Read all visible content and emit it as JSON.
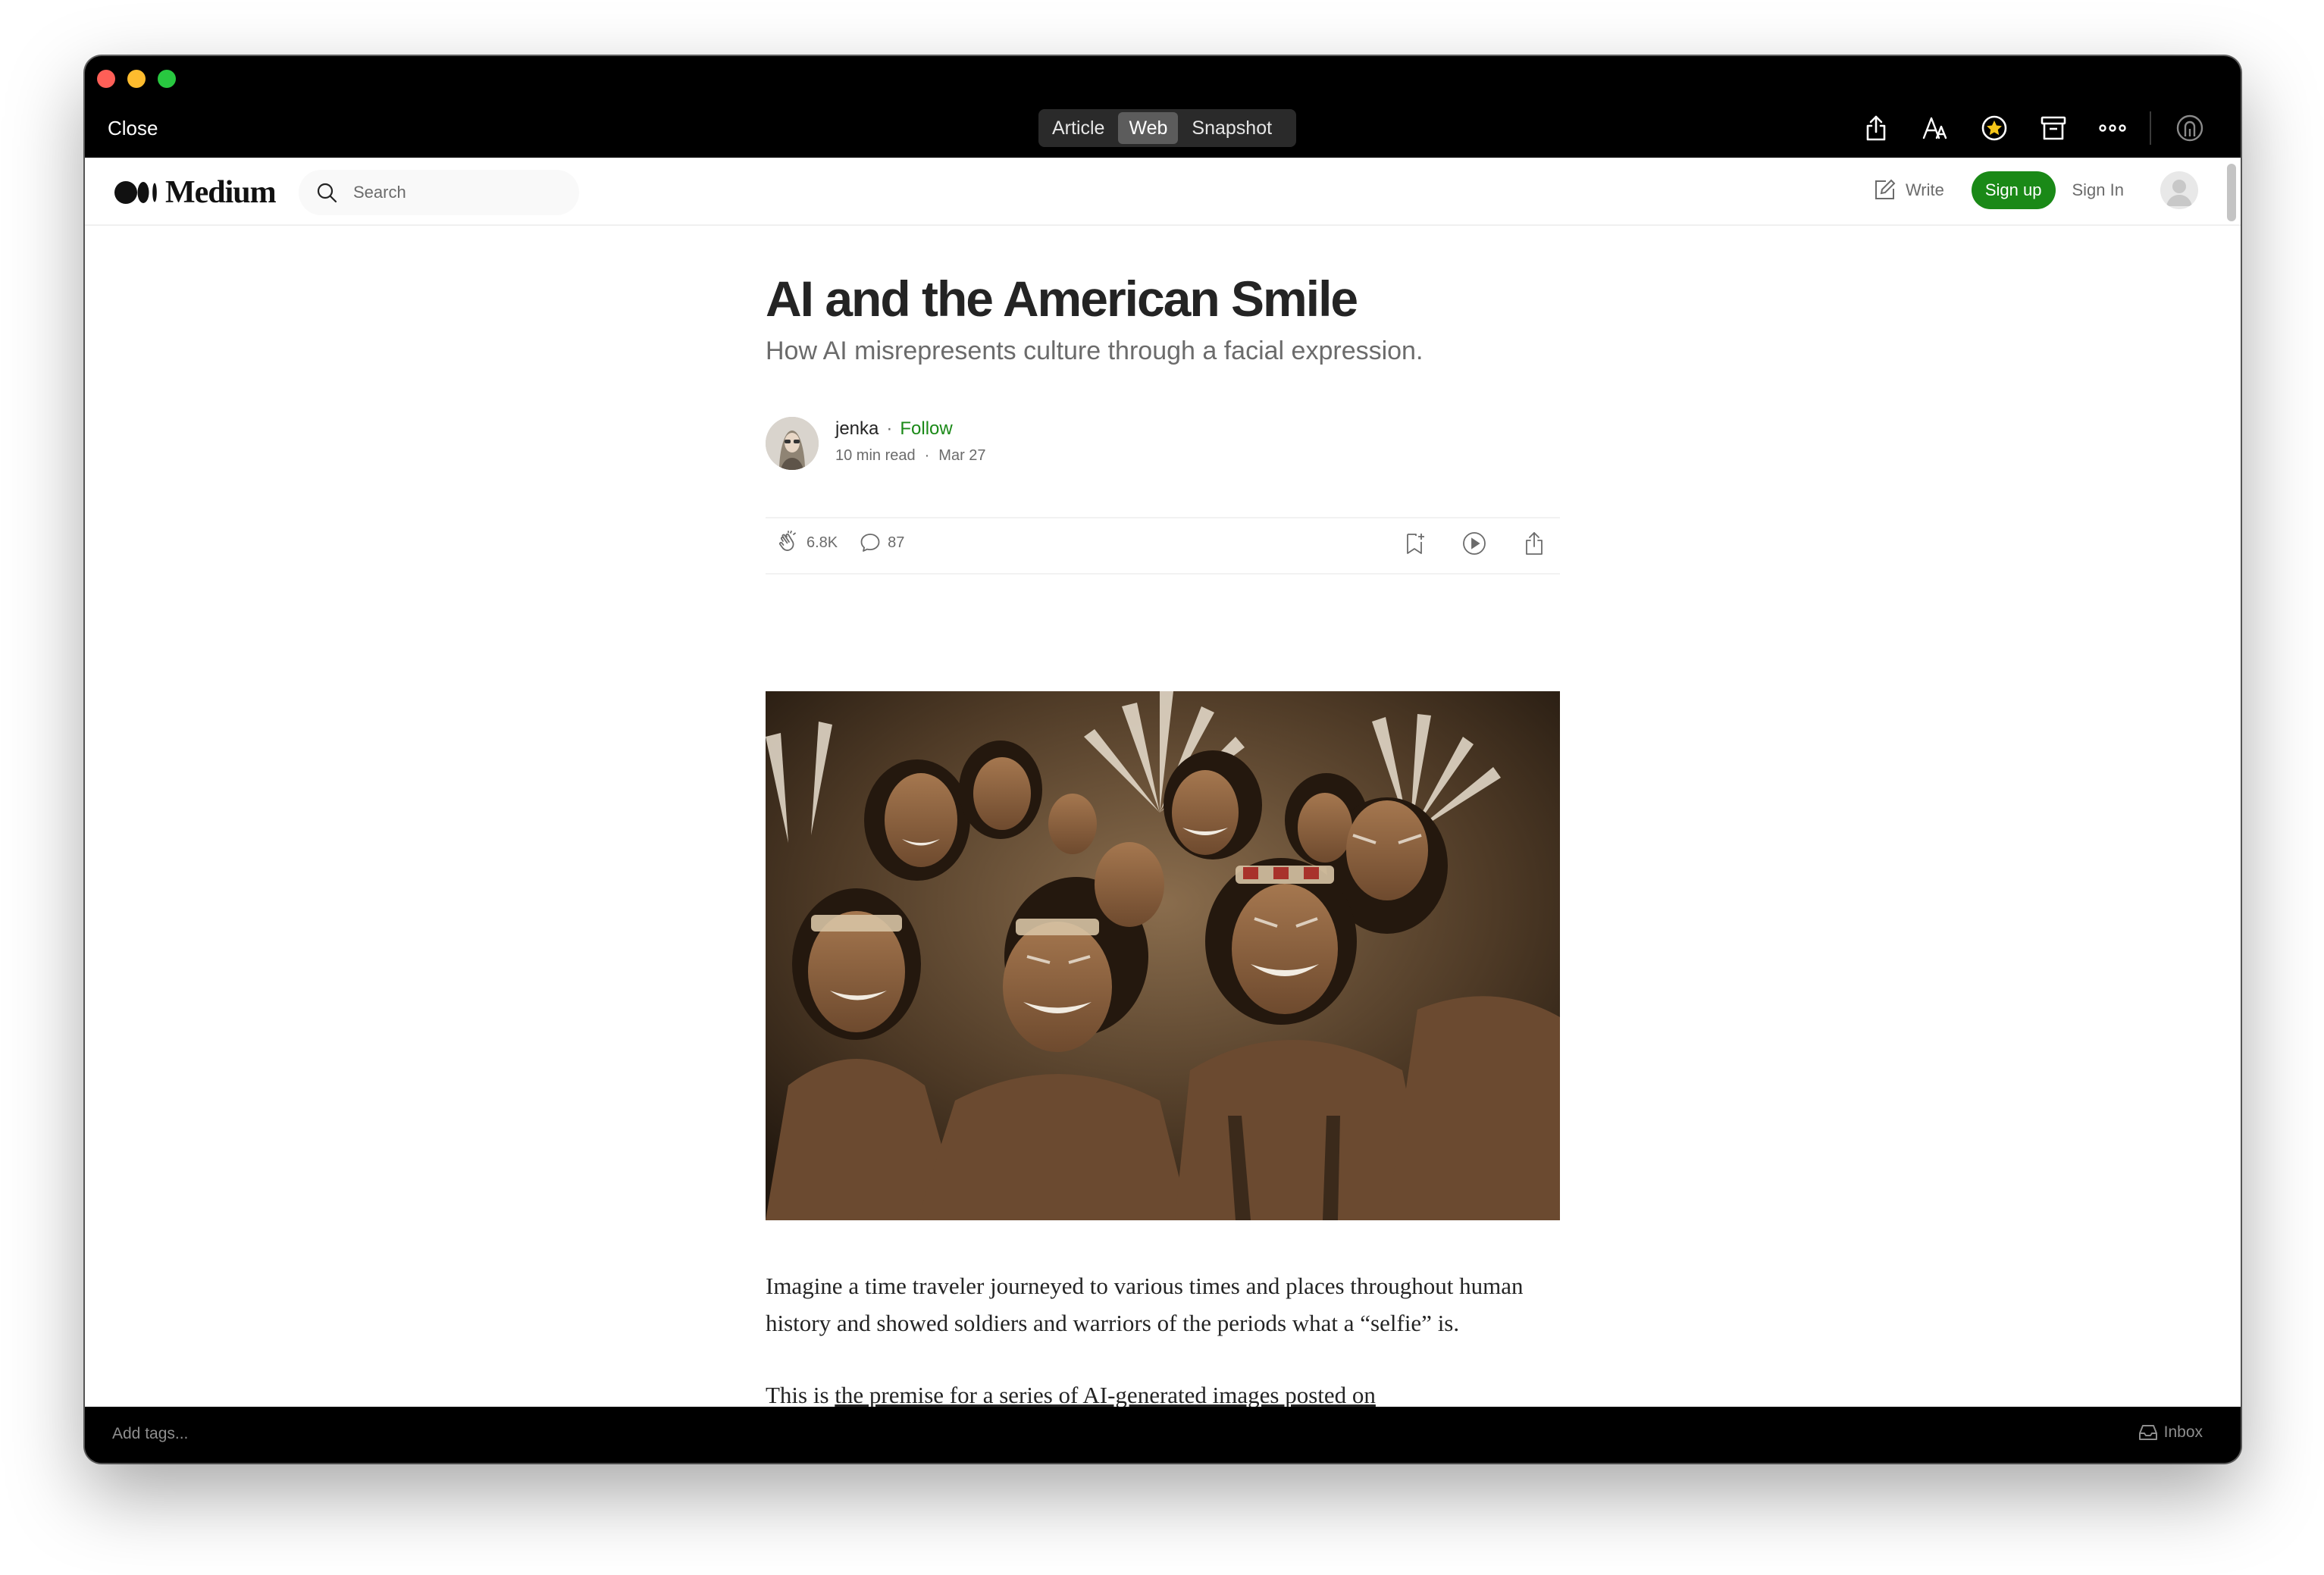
{
  "toolbar": {
    "close_label": "Close",
    "view_modes": [
      "Article",
      "Web",
      "Snapshot"
    ],
    "active_mode": "Web"
  },
  "site": {
    "logo_text": "Medium",
    "search_placeholder": "Search",
    "write_label": "Write",
    "signup_label": "Sign up",
    "signin_label": "Sign In"
  },
  "article": {
    "title": "AI and the American Smile",
    "subtitle": "How AI misrepresents culture through a facial expression.",
    "author": "jenka",
    "follow_label": "Follow",
    "read_time": "10 min read",
    "date": "Mar 27",
    "claps": "6.8K",
    "responses": "87",
    "paragraph1": "Imagine a time traveler journeyed to various times and places throughout human history and showed soldiers and warriors of the periods what a “selfie” is.",
    "paragraph2_prefix": "This is ",
    "paragraph2_link": "the premise for a series of AI-generated images posted on"
  },
  "footer": {
    "tags_placeholder": "Add tags...",
    "inbox_label": "Inbox"
  },
  "colors": {
    "accent_green": "#1a8917",
    "title_text": "#242424",
    "secondary_text": "#6b6b6b"
  },
  "icons": [
    "share-icon",
    "text-size-icon",
    "star-badge-icon",
    "archive-icon",
    "more-icon",
    "account-icon",
    "search-icon",
    "write-icon",
    "clap-icon",
    "comment-icon",
    "bookmark-icon",
    "play-icon",
    "share-article-icon",
    "inbox-icon"
  ]
}
